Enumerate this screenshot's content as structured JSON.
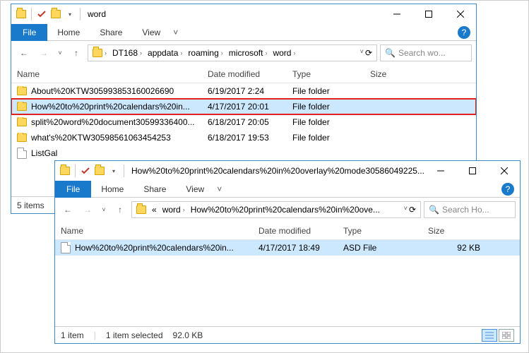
{
  "win1": {
    "title": "word",
    "tabs": {
      "file": "File",
      "home": "Home",
      "share": "Share",
      "view": "View"
    },
    "breadcrumb": [
      "DT168",
      "appdata",
      "roaming",
      "microsoft",
      "word"
    ],
    "search_placeholder": "Search wo...",
    "cols": {
      "name": "Name",
      "date": "Date modified",
      "type": "Type",
      "size": "Size"
    },
    "rows": [
      {
        "name": "About%20KTW305993853160026690",
        "date": "6/19/2017 2:24",
        "type": "File folder",
        "size": ""
      },
      {
        "name": "How%20to%20print%20calendars%20in...",
        "date": "4/17/2017 20:01",
        "type": "File folder",
        "size": ""
      },
      {
        "name": "split%20word%20document30599336400...",
        "date": "6/18/2017 20:05",
        "type": "File folder",
        "size": ""
      },
      {
        "name": "what's%20KTW30598561063454253",
        "date": "6/18/2017 19:53",
        "type": "File folder",
        "size": ""
      },
      {
        "name": "ListGal",
        "date": "",
        "type": "",
        "size": ""
      }
    ],
    "status": "5 items"
  },
  "win2": {
    "title": "How%20to%20print%20calendars%20in%20overlay%20mode30586049225...",
    "tabs": {
      "file": "File",
      "home": "Home",
      "share": "Share",
      "view": "View"
    },
    "breadcrumb_prefix": "«",
    "breadcrumb": [
      "word",
      "How%20to%20print%20calendars%20in%20ove..."
    ],
    "search_placeholder": "Search Ho...",
    "cols": {
      "name": "Name",
      "date": "Date modified",
      "type": "Type",
      "size": "Size"
    },
    "rows": [
      {
        "name": "How%20to%20print%20calendars%20in...",
        "date": "4/17/2017 18:49",
        "type": "ASD File",
        "size": "92 KB"
      }
    ],
    "status1": "1 item",
    "status2": "1 item selected",
    "status3": "92.0 KB"
  }
}
